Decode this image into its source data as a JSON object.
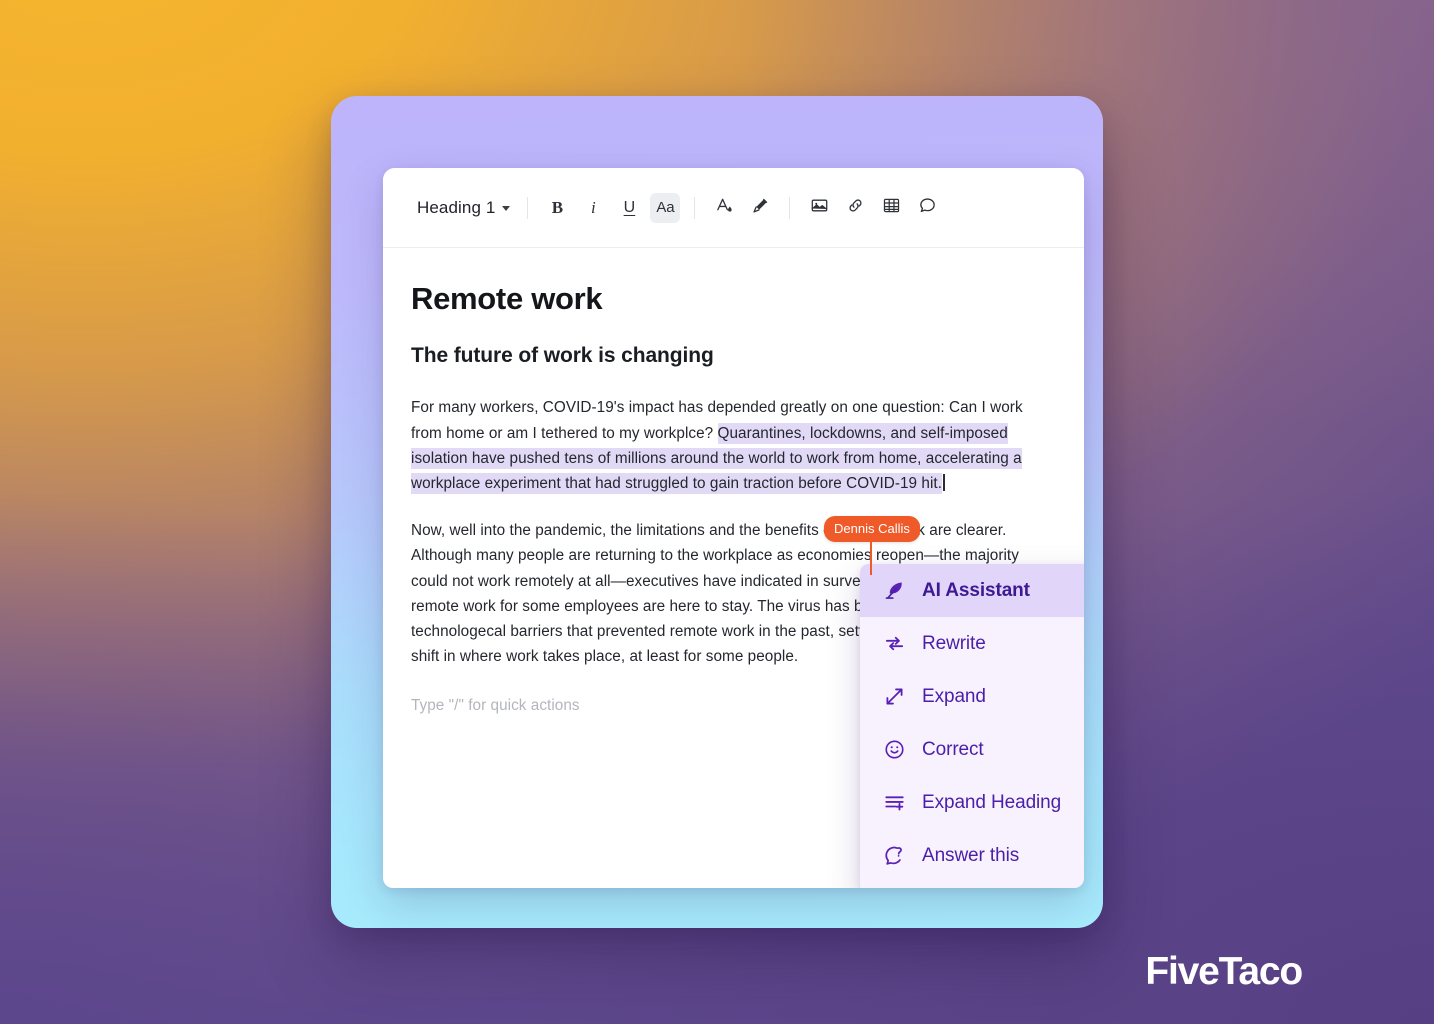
{
  "toolbar": {
    "style_label": "Heading 1",
    "style_caret": "chevron-down-icon",
    "buttons": [
      {
        "name": "bold",
        "label": "B"
      },
      {
        "name": "italic",
        "label": "i"
      },
      {
        "name": "underline",
        "label": "U"
      },
      {
        "name": "text-style",
        "label": "Aa",
        "active": true
      },
      {
        "name": "font-color",
        "label": ""
      },
      {
        "name": "highlighter",
        "label": ""
      },
      {
        "name": "insert-image",
        "label": ""
      },
      {
        "name": "insert-link",
        "label": ""
      },
      {
        "name": "insert-table",
        "label": ""
      },
      {
        "name": "comment",
        "label": ""
      }
    ]
  },
  "document": {
    "title": "Remote work",
    "subtitle": "The future of work is changing",
    "paragraph1_pre": "For many workers, COVID-19's impact has depended greatly on one question: Can I work from home or am I tethered to my workplce? ",
    "paragraph1_highlight": "Quarantines, lockdowns, and self-imposed isolation have pushed tens of millions around the world to work from home, accelerating a workplace experiment that had struggled to gain traction before COVID-19 hit.",
    "paragraph2": "Now, well into the pandemic, the limitations and the benefits of remote work are clearer. Although many people are returning to the workplace as economies reopen—the majority could not work remotely at all—executives have indicated in surveys that hybrid models of remote work for some employees are here to stay. The virus has broken through cultural and technologecal barriers that prevented remote work in the past, setting in motion a structural shift in where work takes place, at least for some people.",
    "placeholder": "Type \"/\" for quick actions"
  },
  "collaborator": {
    "name": "Dennis Callis",
    "color": "#f05a28"
  },
  "ai_menu": {
    "items": [
      {
        "label": "AI Assistant",
        "icon": "feather-icon",
        "selected": true
      },
      {
        "label": "Rewrite",
        "icon": "repeat-arrows-icon",
        "selected": false
      },
      {
        "label": "Expand",
        "icon": "expand-arrows-icon",
        "selected": false
      },
      {
        "label": "Correct",
        "icon": "smiley-face-icon",
        "selected": false
      },
      {
        "label": "Expand Heading",
        "icon": "lines-plus-icon",
        "selected": false
      },
      {
        "label": "Answer this",
        "icon": "question-bubble-icon",
        "selected": false
      }
    ],
    "accent": "#5b21b6",
    "selected_bg": "#e2d5fa"
  },
  "branding": {
    "watermark": "FiveTaco"
  }
}
